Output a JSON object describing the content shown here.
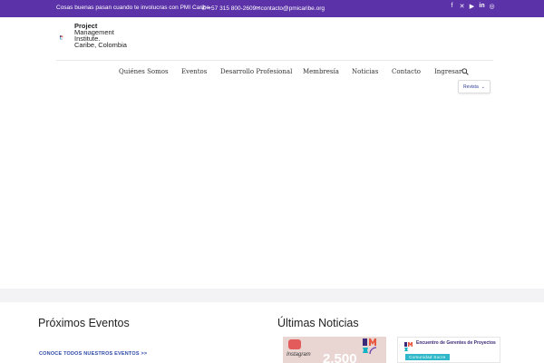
{
  "topbar": {
    "tagline": "Cosas buenas pasan cuando te involucras con PMI Caribe",
    "phone": "+57 315 800-2609",
    "email": "contacto@pmicaribe.org",
    "social_icons": [
      "facebook-icon",
      "x-icon",
      "youtube-icon",
      "linkedin-icon",
      "instagram-icon"
    ]
  },
  "logo": {
    "line1": "Project",
    "line2": "Management",
    "line3": "Institute.",
    "line4": "Caribe, Colombia"
  },
  "nav": {
    "items": [
      "Quiénes Somos",
      "Eventos",
      "Desarrollo Profesional",
      "Membresía",
      "Noticias",
      "Contacto",
      "Ingresar"
    ]
  },
  "revista": {
    "label": "Revista"
  },
  "events": {
    "title": "Próximos Eventos",
    "link": "CONOCE TODOS NUESTROS EVENTOS >>"
  },
  "news": {
    "title": "Últimas Noticias",
    "card1_label": "Instagram",
    "card1_number": "2.500",
    "card2_title": "Encuentro de Gerentes de Proyectos",
    "card2_badge": "Comunidad Sucre"
  },
  "colors": {
    "brand_purple": "#5b32a8",
    "link_blue": "#2c48a8"
  }
}
